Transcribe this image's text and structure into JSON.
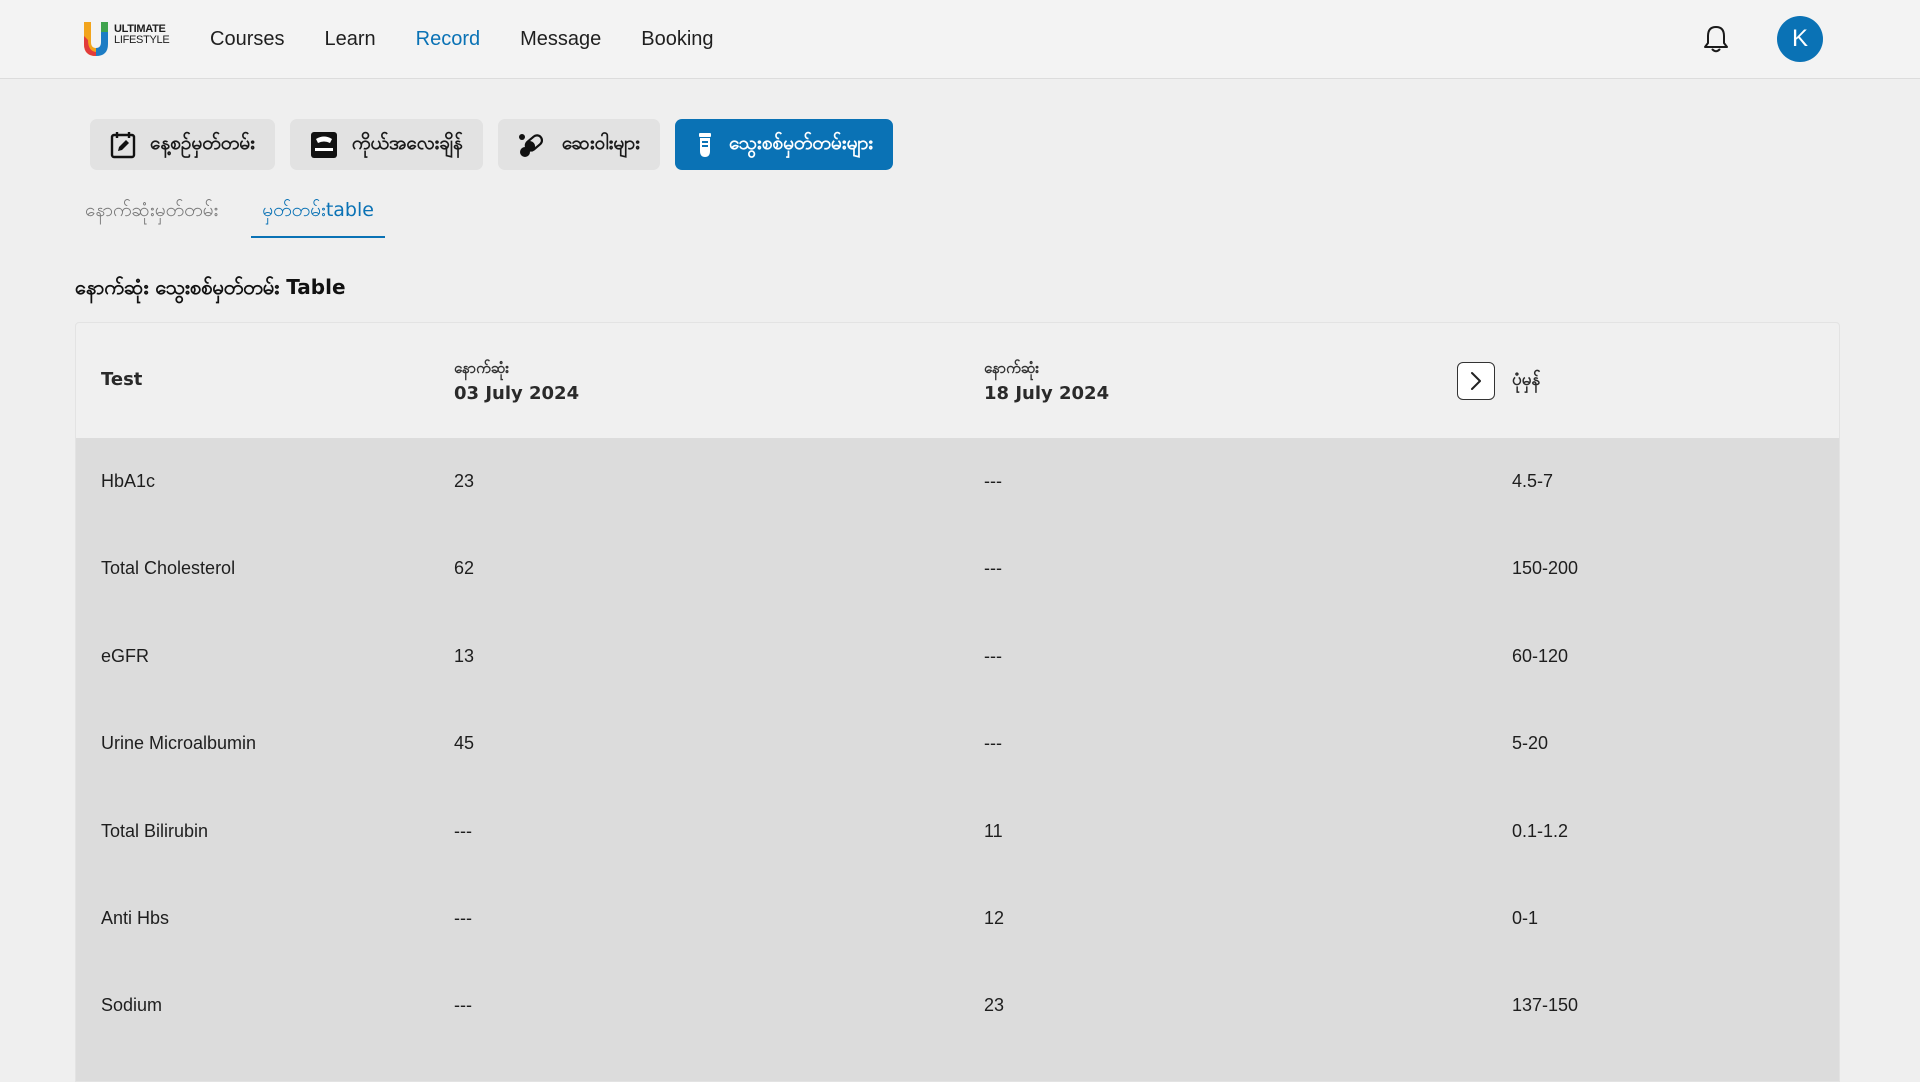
{
  "brand": {
    "line1": "ULTIMATE",
    "line2": "LIFESTYLE"
  },
  "nav": {
    "items": [
      "Courses",
      "Learn",
      "Record",
      "Message",
      "Booking"
    ],
    "active": "Record"
  },
  "user": {
    "initial": "K"
  },
  "category_tabs": [
    {
      "label": "နေ့စဉ်မှတ်တမ်း",
      "icon": "calendar-edit-icon"
    },
    {
      "label": "ကိုယ်အလေးချိန်",
      "icon": "weighing-scale-icon"
    },
    {
      "label": "ဆေးဝါးများ",
      "icon": "pills-icon"
    },
    {
      "label": "သွေးစစ်မှတ်တမ်းများ",
      "icon": "test-tube-icon"
    }
  ],
  "sub_tabs": [
    {
      "label": "နောက်ဆုံးမှတ်တမ်း"
    },
    {
      "label": "မှတ်တမ်းtable"
    }
  ],
  "section_title": "နောက်ဆုံး သွေးစစ်မှတ်တမ်း Table",
  "table": {
    "headers": {
      "test": "Test",
      "col1_label": "နောက်ဆုံး",
      "col1_date": "03 July 2024",
      "col2_label": "နောက်ဆုံး",
      "col2_date": "18 July 2024",
      "normal": "ပုံမှန်"
    },
    "rows": [
      {
        "test": "HbA1c",
        "v1": "23",
        "v2": "---",
        "normal": "4.5-7"
      },
      {
        "test": "Total Cholesterol",
        "v1": "62",
        "v2": "---",
        "normal": "150-200"
      },
      {
        "test": "eGFR",
        "v1": "13",
        "v2": "---",
        "normal": "60-120"
      },
      {
        "test": "Urine Microalbumin",
        "v1": "45",
        "v2": "---",
        "normal": "5-20"
      },
      {
        "test": "Total Bilirubin",
        "v1": "---",
        "v2": "11",
        "normal": "0.1-1.2"
      },
      {
        "test": "Anti Hbs",
        "v1": "---",
        "v2": "12",
        "normal": "0-1"
      },
      {
        "test": "Sodium",
        "v1": "---",
        "v2": "23",
        "normal": "137-150"
      }
    ]
  },
  "colors": {
    "accent": "#0a72b5",
    "background": "#efefef",
    "table_body": "#dcdcdc"
  }
}
